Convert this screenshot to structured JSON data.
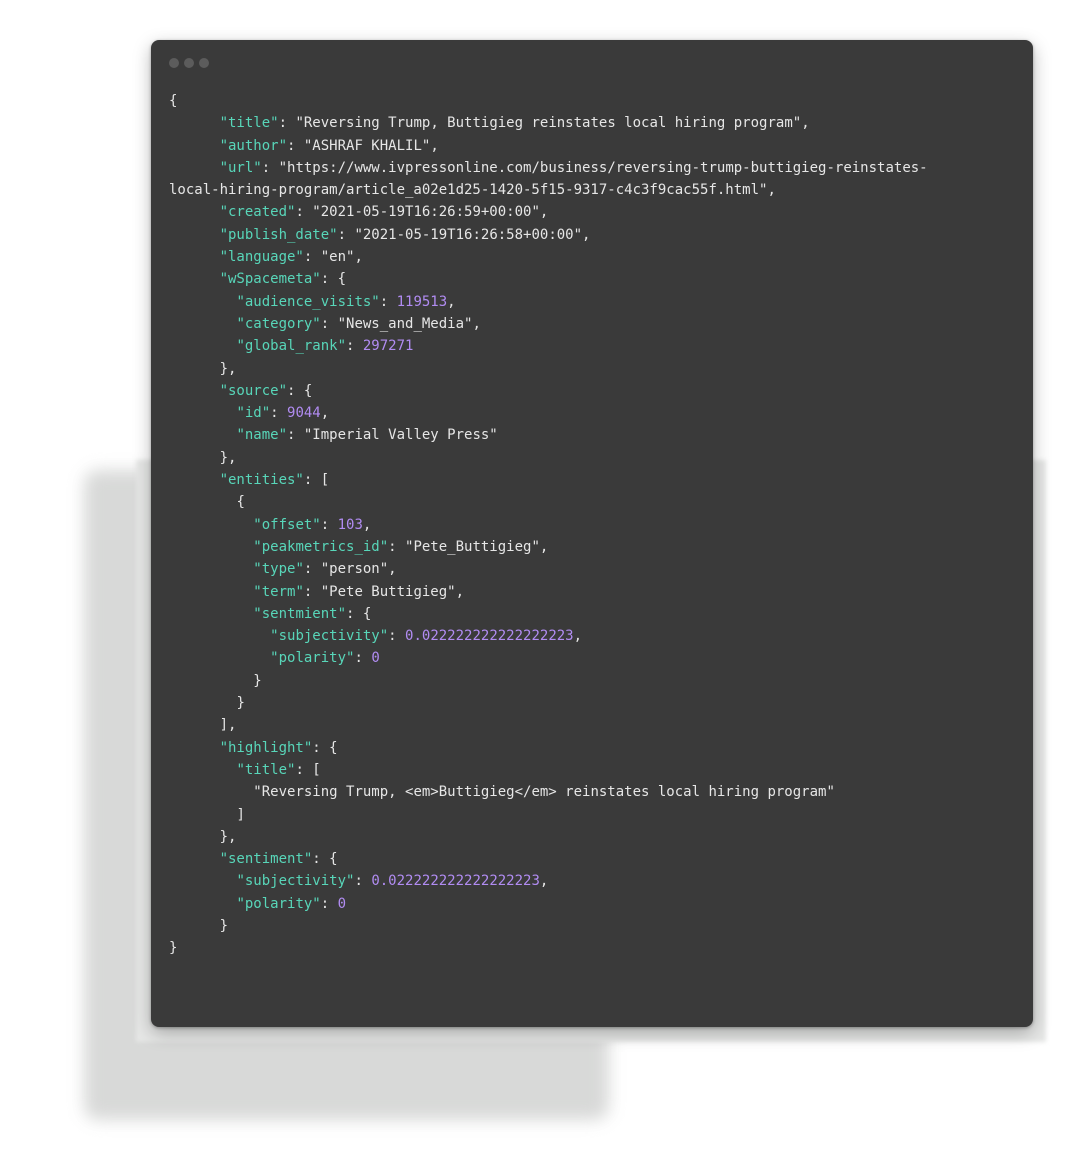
{
  "window": {
    "controls": [
      "dot",
      "dot",
      "dot"
    ]
  },
  "json_lines": [
    [
      {
        "t": "p",
        "v": "{"
      }
    ],
    [
      {
        "t": "i",
        "v": "      "
      },
      {
        "t": "k",
        "v": "\"title\""
      },
      {
        "t": "p",
        "v": ": "
      },
      {
        "t": "s",
        "v": "\"Reversing Trump, Buttigieg reinstates local hiring program\""
      },
      {
        "t": "p",
        "v": ","
      }
    ],
    [
      {
        "t": "i",
        "v": "      "
      },
      {
        "t": "k",
        "v": "\"author\""
      },
      {
        "t": "p",
        "v": ": "
      },
      {
        "t": "s",
        "v": "\"ASHRAF KHALIL\""
      },
      {
        "t": "p",
        "v": ","
      }
    ],
    [
      {
        "t": "i",
        "v": "      "
      },
      {
        "t": "k",
        "v": "\"url\""
      },
      {
        "t": "p",
        "v": ": "
      },
      {
        "t": "s",
        "v": "\"https://www.ivpressonline.com/business/reversing-trump-buttigieg-reinstates-"
      }
    ],
    [
      {
        "t": "s",
        "v": "local-hiring-program/article_a02e1d25-1420-5f15-9317-c4c3f9cac55f.html\""
      },
      {
        "t": "p",
        "v": ","
      }
    ],
    [
      {
        "t": "i",
        "v": "      "
      },
      {
        "t": "k",
        "v": "\"created\""
      },
      {
        "t": "p",
        "v": ": "
      },
      {
        "t": "s",
        "v": "\"2021-05-19T16:26:59+00:00\""
      },
      {
        "t": "p",
        "v": ","
      }
    ],
    [
      {
        "t": "i",
        "v": "      "
      },
      {
        "t": "k",
        "v": "\"publish_date\""
      },
      {
        "t": "p",
        "v": ": "
      },
      {
        "t": "s",
        "v": "\"2021-05-19T16:26:58+00:00\""
      },
      {
        "t": "p",
        "v": ","
      }
    ],
    [
      {
        "t": "i",
        "v": "      "
      },
      {
        "t": "k",
        "v": "\"language\""
      },
      {
        "t": "p",
        "v": ": "
      },
      {
        "t": "s",
        "v": "\"en\""
      },
      {
        "t": "p",
        "v": ","
      }
    ],
    [
      {
        "t": "i",
        "v": "      "
      },
      {
        "t": "k",
        "v": "\"wSpacemeta\""
      },
      {
        "t": "p",
        "v": ": {"
      }
    ],
    [
      {
        "t": "i",
        "v": "        "
      },
      {
        "t": "k",
        "v": "\"audience_visits\""
      },
      {
        "t": "p",
        "v": ": "
      },
      {
        "t": "n",
        "v": "119513"
      },
      {
        "t": "p",
        "v": ","
      }
    ],
    [
      {
        "t": "i",
        "v": "        "
      },
      {
        "t": "k",
        "v": "\"category\""
      },
      {
        "t": "p",
        "v": ": "
      },
      {
        "t": "s",
        "v": "\"News_and_Media\""
      },
      {
        "t": "p",
        "v": ","
      }
    ],
    [
      {
        "t": "i",
        "v": "        "
      },
      {
        "t": "k",
        "v": "\"global_rank\""
      },
      {
        "t": "p",
        "v": ": "
      },
      {
        "t": "n",
        "v": "297271"
      }
    ],
    [
      {
        "t": "i",
        "v": "      "
      },
      {
        "t": "p",
        "v": "},"
      }
    ],
    [
      {
        "t": "i",
        "v": "      "
      },
      {
        "t": "k",
        "v": "\"source\""
      },
      {
        "t": "p",
        "v": ": {"
      }
    ],
    [
      {
        "t": "i",
        "v": "        "
      },
      {
        "t": "k",
        "v": "\"id\""
      },
      {
        "t": "p",
        "v": ": "
      },
      {
        "t": "n",
        "v": "9044"
      },
      {
        "t": "p",
        "v": ","
      }
    ],
    [
      {
        "t": "i",
        "v": "        "
      },
      {
        "t": "k",
        "v": "\"name\""
      },
      {
        "t": "p",
        "v": ": "
      },
      {
        "t": "s",
        "v": "\"Imperial Valley Press\""
      }
    ],
    [
      {
        "t": "i",
        "v": "      "
      },
      {
        "t": "p",
        "v": "},"
      }
    ],
    [
      {
        "t": "i",
        "v": "      "
      },
      {
        "t": "k",
        "v": "\"entities\""
      },
      {
        "t": "p",
        "v": ": ["
      }
    ],
    [
      {
        "t": "i",
        "v": "        "
      },
      {
        "t": "p",
        "v": "{"
      }
    ],
    [
      {
        "t": "i",
        "v": "          "
      },
      {
        "t": "k",
        "v": "\"offset\""
      },
      {
        "t": "p",
        "v": ": "
      },
      {
        "t": "n",
        "v": "103"
      },
      {
        "t": "p",
        "v": ","
      }
    ],
    [
      {
        "t": "i",
        "v": "          "
      },
      {
        "t": "k",
        "v": "\"peakmetrics_id\""
      },
      {
        "t": "p",
        "v": ": "
      },
      {
        "t": "s",
        "v": "\"Pete_Buttigieg\""
      },
      {
        "t": "p",
        "v": ","
      }
    ],
    [
      {
        "t": "i",
        "v": "          "
      },
      {
        "t": "k",
        "v": "\"type\""
      },
      {
        "t": "p",
        "v": ": "
      },
      {
        "t": "s",
        "v": "\"person\""
      },
      {
        "t": "p",
        "v": ","
      }
    ],
    [
      {
        "t": "i",
        "v": "          "
      },
      {
        "t": "k",
        "v": "\"term\""
      },
      {
        "t": "p",
        "v": ": "
      },
      {
        "t": "s",
        "v": "\"Pete Buttigieg\""
      },
      {
        "t": "p",
        "v": ","
      }
    ],
    [
      {
        "t": "i",
        "v": "          "
      },
      {
        "t": "k",
        "v": "\"sentmient\""
      },
      {
        "t": "p",
        "v": ": {"
      }
    ],
    [
      {
        "t": "i",
        "v": "            "
      },
      {
        "t": "k",
        "v": "\"subjectivity\""
      },
      {
        "t": "p",
        "v": ": "
      },
      {
        "t": "n",
        "v": "0.022222222222222223"
      },
      {
        "t": "p",
        "v": ","
      }
    ],
    [
      {
        "t": "i",
        "v": "            "
      },
      {
        "t": "k",
        "v": "\"polarity\""
      },
      {
        "t": "p",
        "v": ": "
      },
      {
        "t": "n",
        "v": "0"
      }
    ],
    [
      {
        "t": "i",
        "v": "          "
      },
      {
        "t": "p",
        "v": "}"
      }
    ],
    [
      {
        "t": "i",
        "v": "        "
      },
      {
        "t": "p",
        "v": "}"
      }
    ],
    [
      {
        "t": "i",
        "v": "      "
      },
      {
        "t": "p",
        "v": "],"
      }
    ],
    [
      {
        "t": "i",
        "v": "      "
      },
      {
        "t": "k",
        "v": "\"highlight\""
      },
      {
        "t": "p",
        "v": ": {"
      }
    ],
    [
      {
        "t": "i",
        "v": "        "
      },
      {
        "t": "k",
        "v": "\"title\""
      },
      {
        "t": "p",
        "v": ": ["
      }
    ],
    [
      {
        "t": "i",
        "v": "          "
      },
      {
        "t": "s",
        "v": "\"Reversing Trump, <em>Buttigieg</em> reinstates local hiring program\""
      }
    ],
    [
      {
        "t": "i",
        "v": "        "
      },
      {
        "t": "p",
        "v": "]"
      }
    ],
    [
      {
        "t": "i",
        "v": "      "
      },
      {
        "t": "p",
        "v": "},"
      }
    ],
    [
      {
        "t": "i",
        "v": "      "
      },
      {
        "t": "k",
        "v": "\"sentiment\""
      },
      {
        "t": "p",
        "v": ": {"
      }
    ],
    [
      {
        "t": "i",
        "v": "        "
      },
      {
        "t": "k",
        "v": "\"subjectivity\""
      },
      {
        "t": "p",
        "v": ": "
      },
      {
        "t": "n",
        "v": "0.022222222222222223"
      },
      {
        "t": "p",
        "v": ","
      }
    ],
    [
      {
        "t": "i",
        "v": "        "
      },
      {
        "t": "k",
        "v": "\"polarity\""
      },
      {
        "t": "p",
        "v": ": "
      },
      {
        "t": "n",
        "v": "0"
      }
    ],
    [
      {
        "t": "i",
        "v": "      "
      },
      {
        "t": "p",
        "v": "}"
      }
    ],
    [
      {
        "t": "p",
        "v": "}"
      }
    ]
  ],
  "colors": {
    "window_bg": "#3a3a3a",
    "key": "#58d6b9",
    "string": "#e6e6e6",
    "number": "#b18cf2",
    "control_dot": "#5c5c5c"
  }
}
